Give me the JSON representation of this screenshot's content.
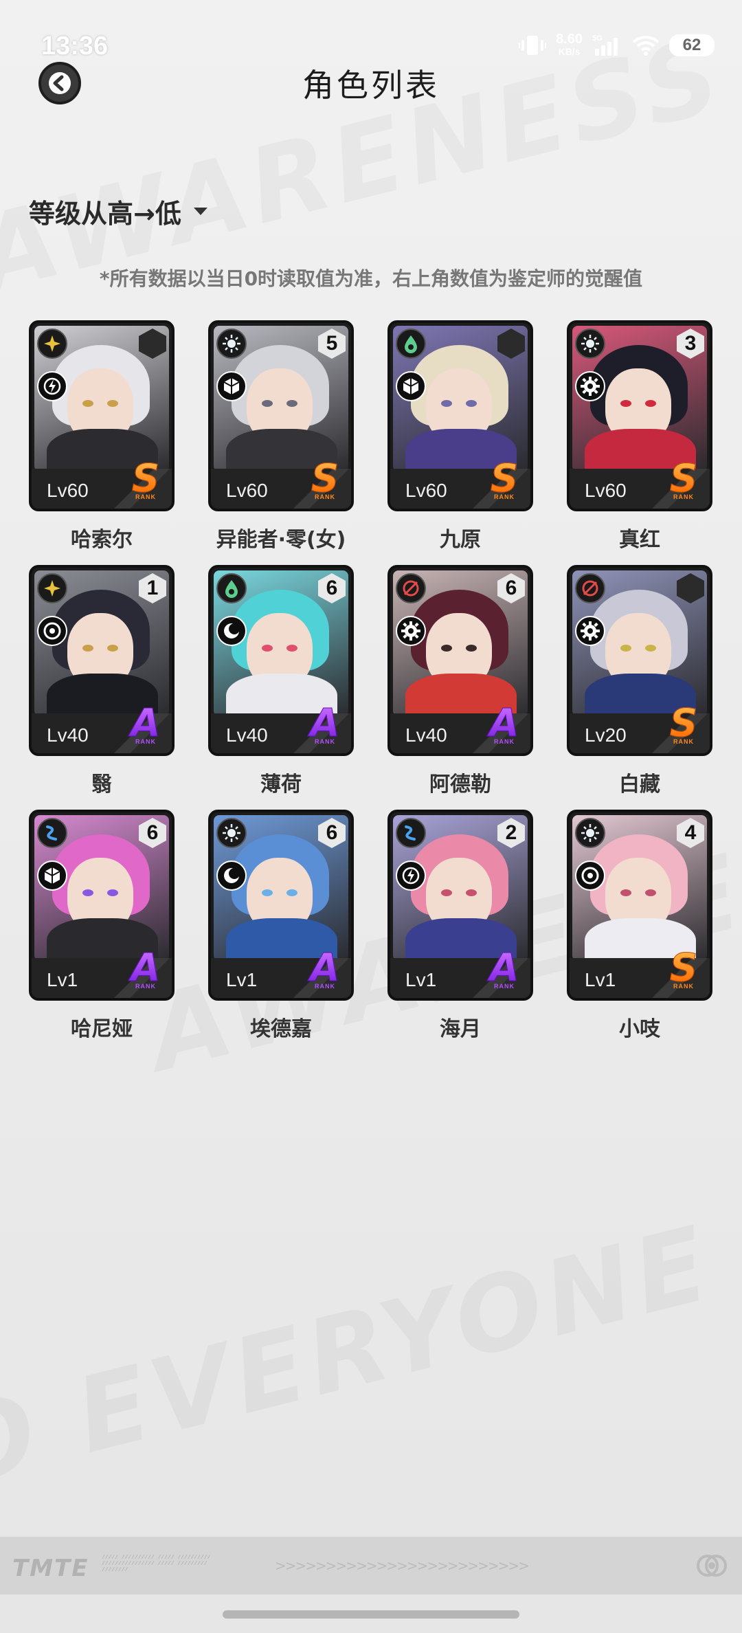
{
  "status_bar": {
    "time": "13:36",
    "net_speed_value": "8.60",
    "net_speed_unit": "KB/s",
    "network": "5G",
    "battery": "62"
  },
  "header": {
    "title": "角色列表"
  },
  "sort": {
    "label": "等级从高→低"
  },
  "note": "*所有数据以当日0时读取值为准，右上角数值为鉴定师的觉醒值",
  "characters": [
    {
      "name": "哈索尔",
      "level": "Lv60",
      "rank": "S",
      "awaken": "",
      "element": "yellow-star",
      "element_color": "#e8c23a",
      "type_icon": "lightning-icon",
      "hair": "#e6e6ea",
      "outfit": "#2c2c30",
      "bg": "#cfcfd4",
      "eye": "#c9a04a"
    },
    {
      "name": "异能者·零(女)",
      "level": "Lv60",
      "rank": "S",
      "awaken": "5",
      "element": "white-sun",
      "element_color": "#e9f3f6",
      "type_icon": "cube-icon",
      "hair": "#d3d3da",
      "outfit": "#333338",
      "bg": "#b9b9c1",
      "eye": "#6a6a7a"
    },
    {
      "name": "九原",
      "level": "Lv60",
      "rank": "S",
      "awaken": "",
      "element": "green-drop",
      "element_color": "#5ccf8f",
      "type_icon": "cube-icon",
      "hair": "#e7dcc4",
      "outfit": "#4a3d8a",
      "bg": "#7e77b4",
      "eye": "#6f6aa8"
    },
    {
      "name": "真红",
      "level": "Lv60",
      "rank": "S",
      "awaken": "3",
      "element": "white-sun",
      "element_color": "#e9f3f6",
      "type_icon": "gear-icon",
      "hair": "#1e1e2a",
      "outfit": "#c4293f",
      "bg": "#d8587a",
      "eye": "#d02a3e"
    },
    {
      "name": "翳",
      "level": "Lv40",
      "rank": "A",
      "awaken": "1",
      "element": "yellow-star",
      "element_color": "#e8c23a",
      "type_icon": "spiral-icon",
      "hair": "#2a2a36",
      "outfit": "#1b1b22",
      "bg": "#8b8d96",
      "eye": "#c9a04a"
    },
    {
      "name": "薄荷",
      "level": "Lv40",
      "rank": "A",
      "awaken": "6",
      "element": "green-drop",
      "element_color": "#5ccf8f",
      "type_icon": "moon-icon",
      "hair": "#4fd1d6",
      "outfit": "#e9e9ee",
      "bg": "#7ad7df",
      "eye": "#e0506e"
    },
    {
      "name": "阿德勒",
      "level": "Lv40",
      "rank": "A",
      "awaken": "6",
      "element": "red-target",
      "element_color": "#e54a4a",
      "type_icon": "gear-icon",
      "hair": "#5a2230",
      "outfit": "#d23a36",
      "bg": "#c8b4b4",
      "eye": "#3a2a2a"
    },
    {
      "name": "白藏",
      "level": "Lv20",
      "rank": "S",
      "awaken": "",
      "element": "red-target",
      "element_color": "#e54a4a",
      "type_icon": "gear-icon",
      "hair": "#c8c8d6",
      "outfit": "#2a3a78",
      "bg": "#8f93b8",
      "eye": "#c8b448"
    },
    {
      "name": "哈尼娅",
      "level": "Lv1",
      "rank": "A",
      "awaken": "6",
      "element": "blue-wave",
      "element_color": "#4aa2f0",
      "type_icon": "cube-icon",
      "hair": "#e068c8",
      "outfit": "#2a2a2e",
      "bg": "#d68ad0",
      "eye": "#8a58e0"
    },
    {
      "name": "埃德嘉",
      "level": "Lv1",
      "rank": "A",
      "awaken": "6",
      "element": "white-sun",
      "element_color": "#e9f3f6",
      "type_icon": "moon-icon",
      "hair": "#5a8fd6",
      "outfit": "#2f5aa8",
      "bg": "#6e9ad8",
      "eye": "#6ab0e6"
    },
    {
      "name": "海月",
      "level": "Lv1",
      "rank": "A",
      "awaken": "2",
      "element": "blue-wave",
      "element_color": "#4aa2f0",
      "type_icon": "lightning-icon",
      "hair": "#ea8aa8",
      "outfit": "#3a3f8f",
      "bg": "#a9a4d8",
      "eye": "#c6506e"
    },
    {
      "name": "小吱",
      "level": "Lv1",
      "rank": "S",
      "awaken": "4",
      "element": "white-sun",
      "element_color": "#e9f3f6",
      "type_icon": "spiral-icon",
      "hair": "#f0b4c4",
      "outfit": "#ececf2",
      "bg": "#e4c8d2",
      "eye": "#c0506e"
    }
  ],
  "rank_sub_label": "RANK"
}
